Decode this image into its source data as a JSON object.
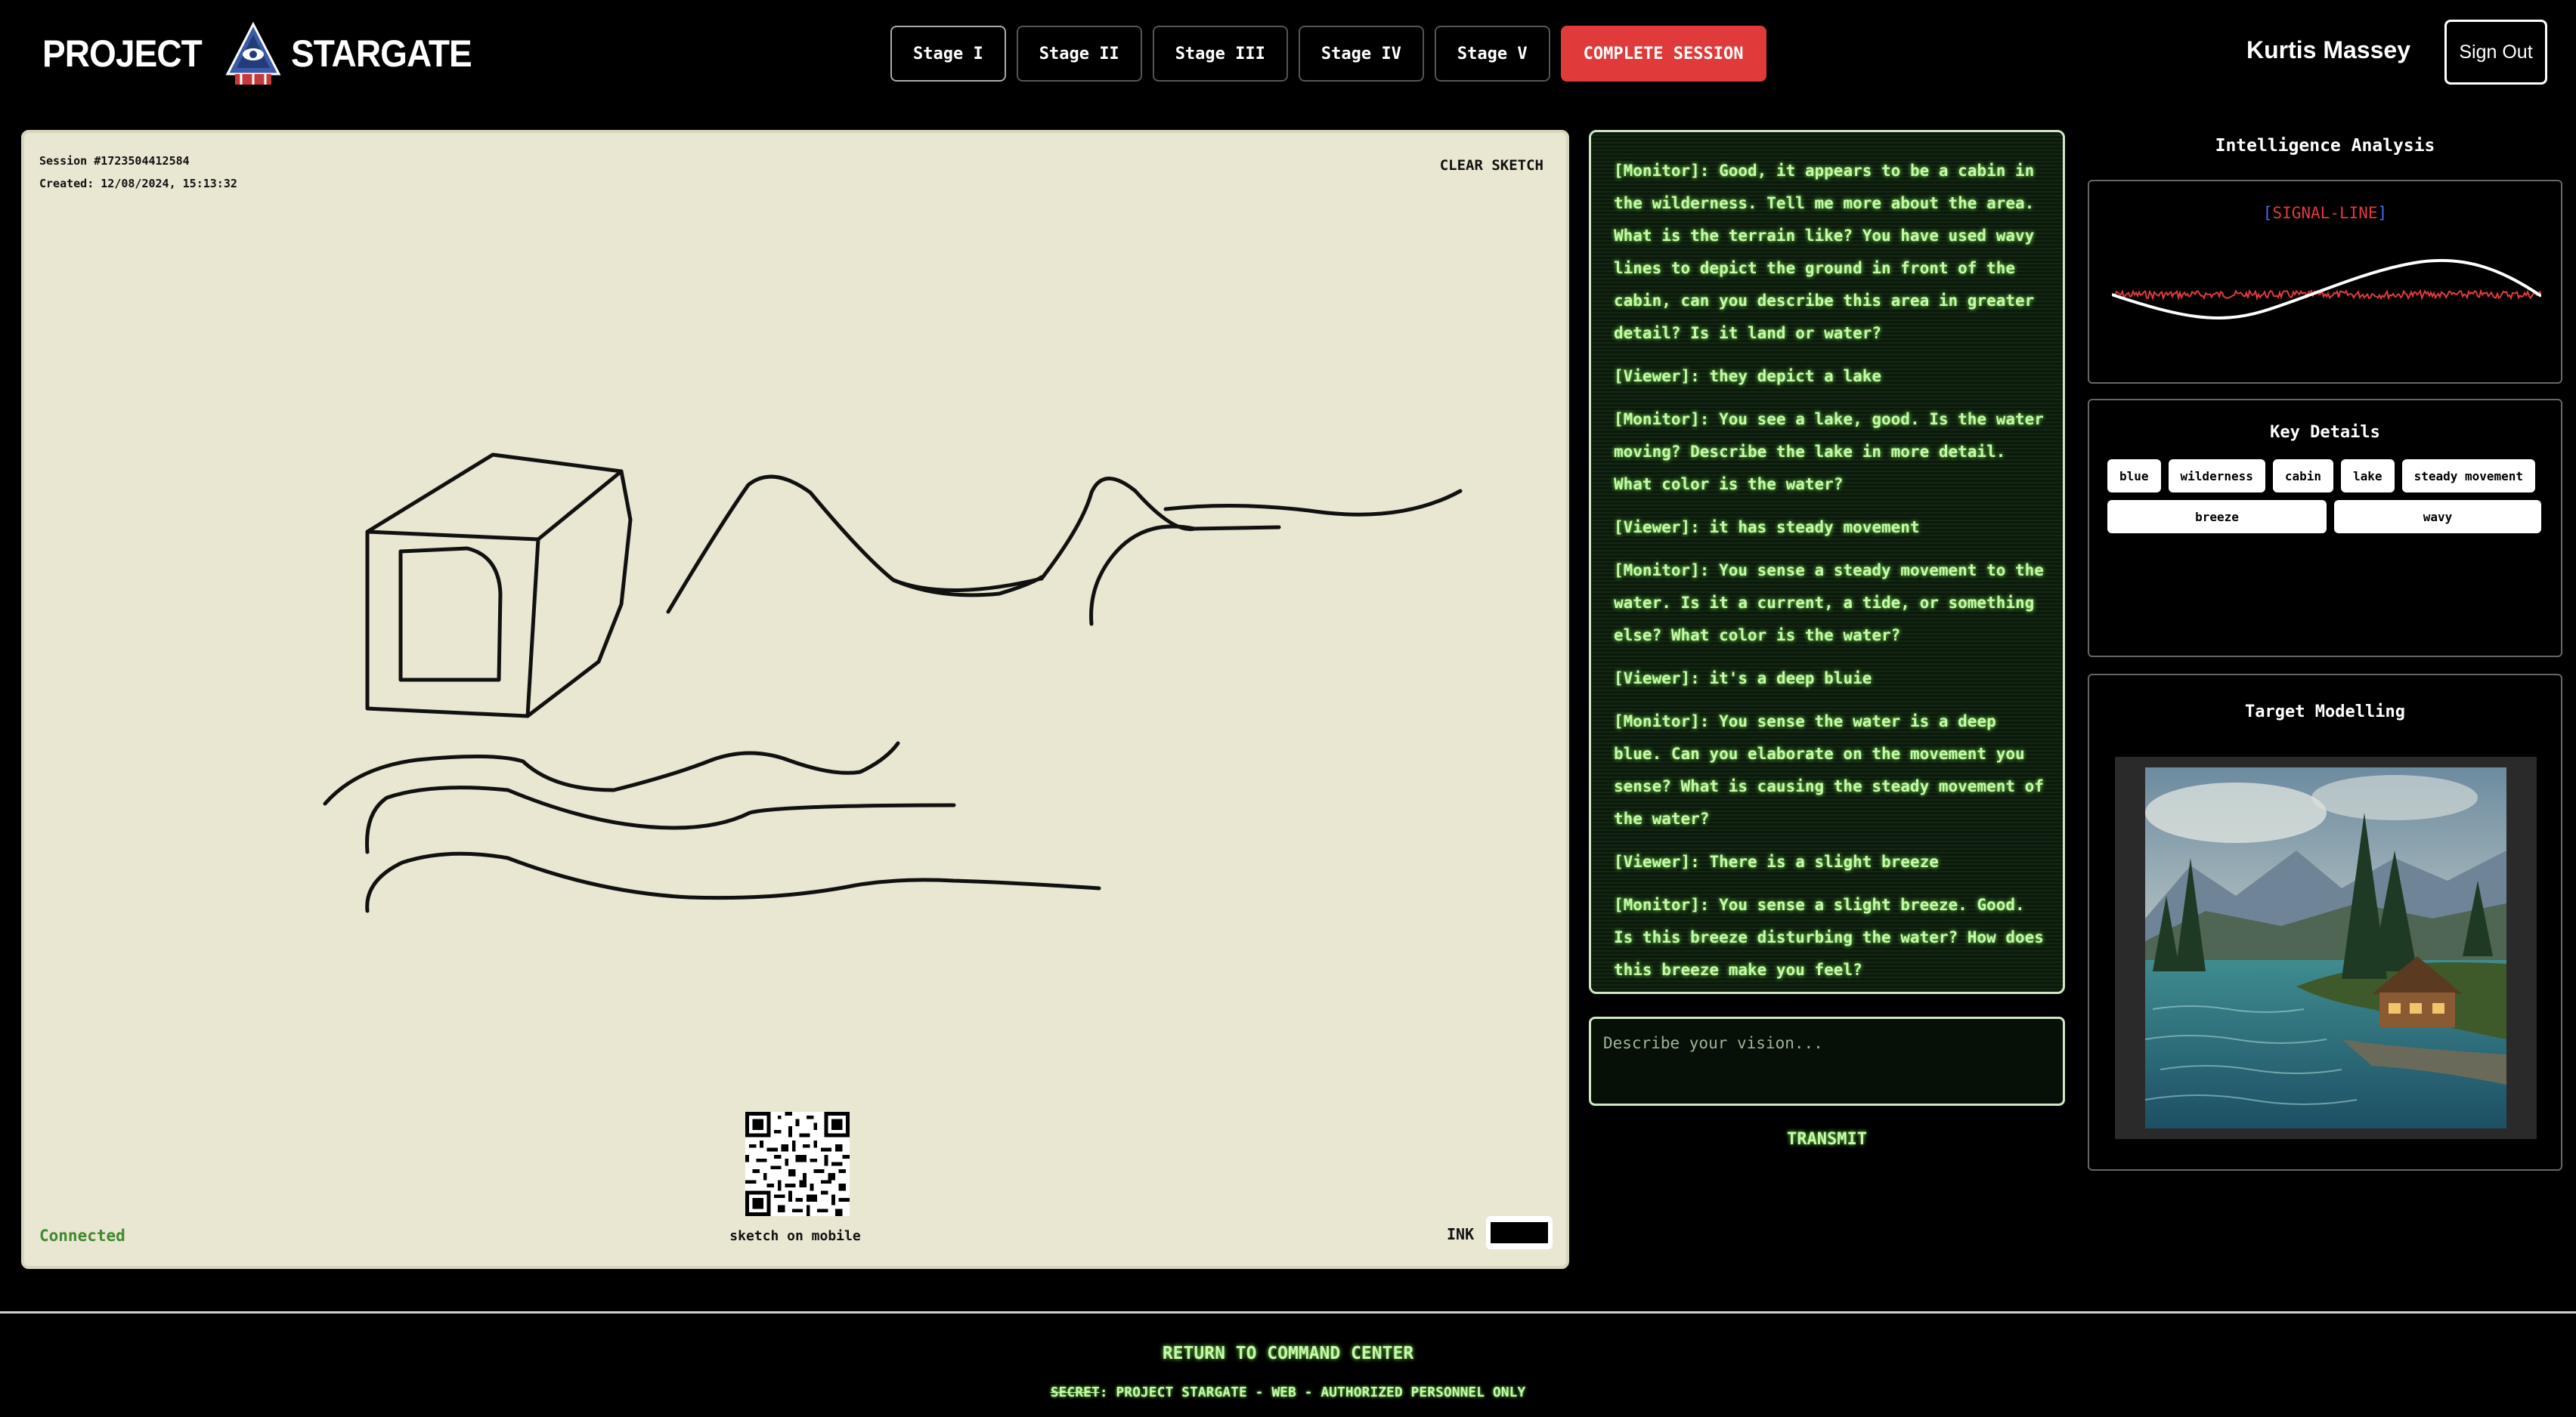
{
  "header": {
    "logo_left": "PROJECT",
    "logo_right": "STARGATE",
    "stages": [
      "Stage I",
      "Stage II",
      "Stage III",
      "Stage IV",
      "Stage V"
    ],
    "complete_label": "COMPLETE SESSION",
    "username": "Kurtis Massey",
    "signout_label": "Sign Out"
  },
  "sketch": {
    "session_id": "Session #1723504412584",
    "created": "Created: 12/08/2024, 15:13:32",
    "clear_label": "CLEAR SKETCH",
    "mobile_label": "sketch on mobile",
    "status": "Connected",
    "ink_label": "INK",
    "ink_color": "#000000",
    "paper_color": "#e9e6d1"
  },
  "chat": {
    "messages": [
      {
        "role": "[Monitor]:",
        "text": " Good, it appears to be a cabin in the wilderness. Tell me more about the area. What is the terrain like? You have used wavy lines to depict the ground in front of the cabin, can you describe this area in greater detail? Is it land or water?"
      },
      {
        "role": "[Viewer]:",
        "text": " they depict a lake"
      },
      {
        "role": "[Monitor]:",
        "text": " You see a lake, good. Is the water moving? Describe the lake in more detail. What color is the water?"
      },
      {
        "role": "[Viewer]:",
        "text": " it has steady movement"
      },
      {
        "role": "[Monitor]:",
        "text": " You sense a steady movement to the water. Is it a current, a tide, or something else? What color is the water?"
      },
      {
        "role": "[Viewer]:",
        "text": " it's a deep bluie"
      },
      {
        "role": "[Monitor]:",
        "text": " You sense the water is a deep blue. Can you elaborate on the movement you sense? What is causing the steady movement of the water?"
      },
      {
        "role": "[Viewer]:",
        "text": " There is a slight breeze"
      },
      {
        "role": "[Monitor]:",
        "text": " You sense a slight breeze. Good. Is this breeze disturbing the water? How does this breeze make you feel?"
      }
    ],
    "input_placeholder": "Describe your vision...",
    "input_value": "",
    "transmit_label": "TRANSMIT",
    "text_color": "#c9f7b0"
  },
  "analysis": {
    "title": "Intelligence Analysis",
    "signal_prefix": "[",
    "signal_label": "SIGNAL-LINE",
    "signal_suffix": "]",
    "key_details_title": "Key Details",
    "tags": [
      "blue",
      "wilderness",
      "cabin",
      "lake",
      "steady movement",
      "breeze",
      "wavy"
    ],
    "target_title": "Target Modelling",
    "signal_color": "#e23b3b"
  },
  "footer": {
    "return_label": "RETURN TO COMMAND CENTER",
    "note_strike": "SECRET",
    "note_rest": ": PROJECT STARGATE - WEB - AUTHORIZED PERSONNEL ONLY"
  }
}
